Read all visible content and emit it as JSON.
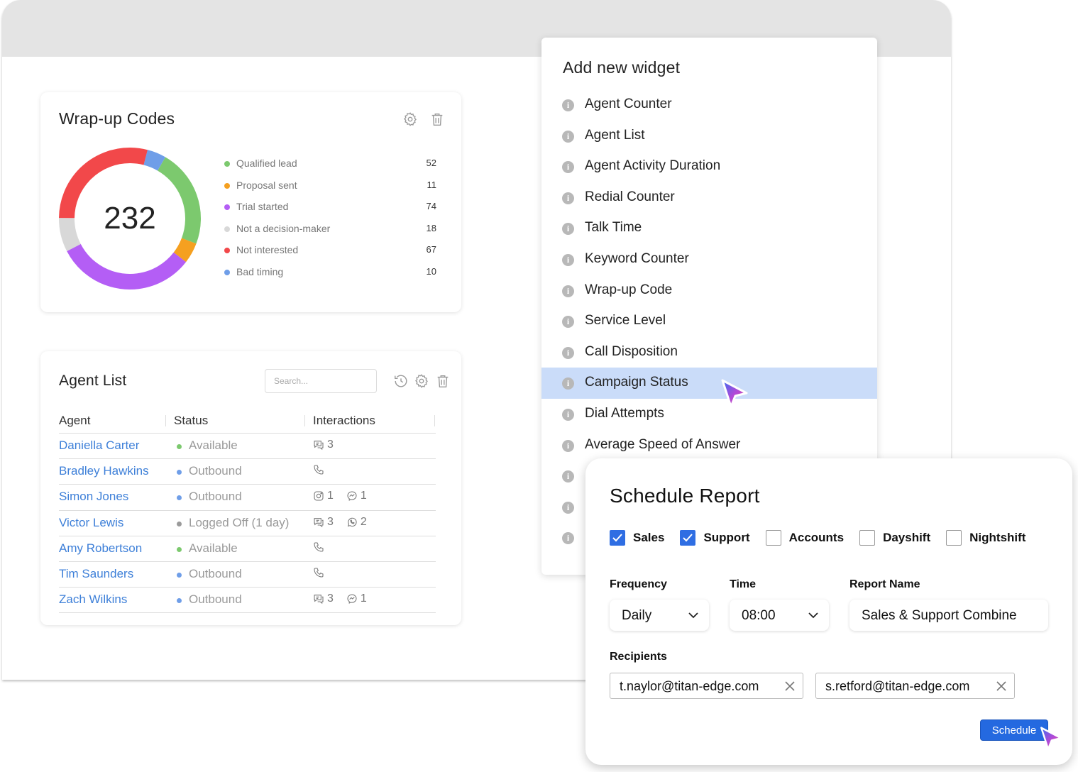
{
  "wrapup": {
    "title": "Wrap-up Codes",
    "total": "232",
    "items": [
      {
        "label": "Qualified lead",
        "value": 52,
        "color": "#7cc96e"
      },
      {
        "label": "Proposal sent",
        "value": 11,
        "color": "#f5a020"
      },
      {
        "label": "Trial started",
        "value": 74,
        "color": "#b45ef5"
      },
      {
        "label": "Not a decision-maker",
        "value": 18,
        "color": "#d8d8d8"
      },
      {
        "label": "Not interested",
        "value": 67,
        "color": "#f2484a"
      },
      {
        "label": "Bad timing",
        "value": 10,
        "color": "#6f9ee8"
      }
    ]
  },
  "chart_data": {
    "type": "pie",
    "categories": [
      "Qualified lead",
      "Proposal sent",
      "Trial started",
      "Not a decision-maker",
      "Not interested",
      "Bad timing"
    ],
    "values": [
      52,
      11,
      74,
      18,
      67,
      10
    ],
    "title": "Wrap-up Codes"
  },
  "agents": {
    "title": "Agent List",
    "search_placeholder": "Search...",
    "columns": [
      "Agent",
      "Status",
      "Interactions"
    ],
    "rows": [
      {
        "name": "Daniella Carter",
        "status": "Available",
        "status_color": "#7cc96e",
        "interactions": [
          {
            "icon": "chat-icon",
            "count": "3"
          }
        ]
      },
      {
        "name": "Bradley Hawkins",
        "status": "Outbound",
        "status_color": "#6f9ee8",
        "interactions": [
          {
            "icon": "phone-icon",
            "count": ""
          }
        ]
      },
      {
        "name": "Simon Jones",
        "status": "Outbound",
        "status_color": "#6f9ee8",
        "interactions": [
          {
            "icon": "instagram-icon",
            "count": "1"
          },
          {
            "icon": "messenger-icon",
            "count": "1"
          }
        ]
      },
      {
        "name": "Victor Lewis",
        "status": "Logged Off (1 day)",
        "status_color": "#9a9a9a",
        "interactions": [
          {
            "icon": "chat-icon",
            "count": "3"
          },
          {
            "icon": "whatsapp-icon",
            "count": "2"
          }
        ]
      },
      {
        "name": "Amy Robertson",
        "status": "Available",
        "status_color": "#7cc96e",
        "interactions": [
          {
            "icon": "phone-icon",
            "count": ""
          }
        ]
      },
      {
        "name": "Tim Saunders",
        "status": "Outbound",
        "status_color": "#6f9ee8",
        "interactions": [
          {
            "icon": "phone-icon",
            "count": ""
          }
        ]
      },
      {
        "name": "Zach Wilkins",
        "status": "Outbound",
        "status_color": "#6f9ee8",
        "interactions": [
          {
            "icon": "chat-icon",
            "count": "3"
          },
          {
            "icon": "messenger-icon",
            "count": "1"
          }
        ]
      }
    ]
  },
  "widgets": {
    "title": "Add new widget",
    "items": [
      "Agent Counter",
      "Agent List",
      "Agent Activity Duration",
      "Redial Counter",
      "Talk Time",
      "Keyword Counter",
      "Wrap-up Code",
      "Service Level",
      "Call Disposition",
      "Campaign Status",
      "Dial Attempts",
      "Average Speed of Answer",
      "",
      "",
      ""
    ],
    "active_index": 9
  },
  "schedule": {
    "title": "Schedule Report",
    "checkboxes": [
      {
        "label": "Sales",
        "checked": true
      },
      {
        "label": "Support",
        "checked": true
      },
      {
        "label": "Accounts",
        "checked": false
      },
      {
        "label": "Dayshift",
        "checked": false
      },
      {
        "label": "Nightshift",
        "checked": false
      }
    ],
    "frequency_label": "Frequency",
    "frequency_value": "Daily",
    "time_label": "Time",
    "time_value": "08:00",
    "report_name_label": "Report Name",
    "report_name_value": "Sales & Support Combine",
    "recipients_label": "Recipients",
    "recipients": [
      "t.naylor@titan-edge.com",
      "s.retford@titan-edge.com"
    ],
    "button_label": "Schedule"
  },
  "colors": {
    "accent": "#2469e0",
    "link": "#3d7fd8",
    "highlight": "#cadcf9"
  }
}
